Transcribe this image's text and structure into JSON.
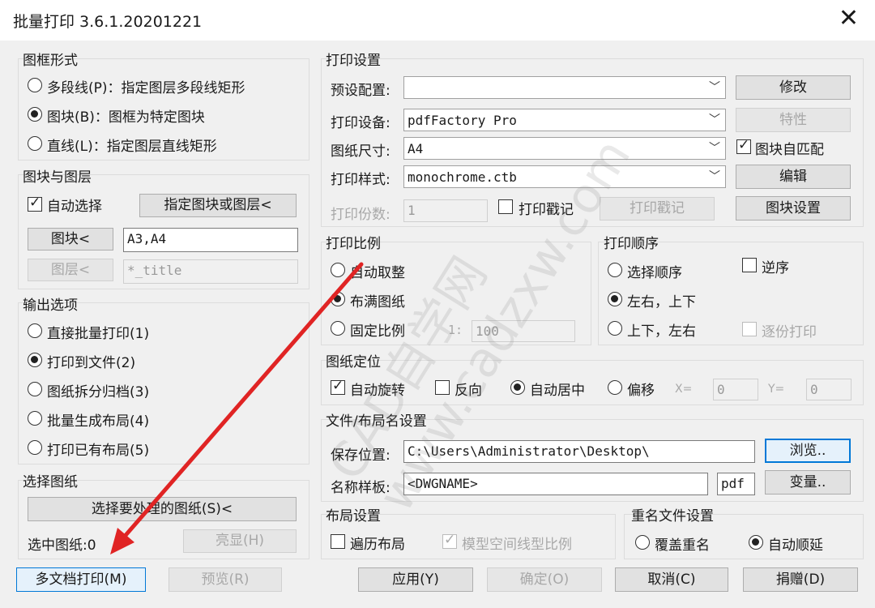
{
  "window": {
    "title": "批量打印 3.6.1.20201221",
    "close_icon": "close-icon"
  },
  "frame_style": {
    "label": "图框形式",
    "options": [
      {
        "text": "多段线(P)：指定图层多段线矩形",
        "selected": false
      },
      {
        "text": "图块(B)：图框为特定图块",
        "selected": true
      },
      {
        "text": "直线(L)：指定图层直线矩形",
        "selected": false
      }
    ]
  },
  "block_layer": {
    "label": "图块与图层",
    "auto_select": "自动选择",
    "specify_button": "指定图块或图层<",
    "block_button": "图块<",
    "block_value": "A3,A4",
    "layer_button": "图层<",
    "layer_value": "*_title"
  },
  "output": {
    "label": "输出选项",
    "options": [
      {
        "text": "直接批量打印(1)",
        "selected": false
      },
      {
        "text": "打印到文件(2)",
        "selected": true
      },
      {
        "text": "图纸拆分归档(3)",
        "selected": false
      },
      {
        "text": "批量生成布局(4)",
        "selected": false
      },
      {
        "text": "打印已有布局(5)",
        "selected": false
      }
    ]
  },
  "select_drawing": {
    "label": "选择图纸",
    "select_button": "选择要处理的图纸(S)<",
    "count_text": "选中图纸:0",
    "highlight_button": "亮显(H)"
  },
  "print_settings": {
    "label": "打印设置",
    "preset_label": "预设配置:",
    "preset_value": "",
    "modify_button": "修改",
    "device_label": "打印设备:",
    "device_value": "pdfFactory Pro",
    "props_button": "特性",
    "paper_label": "图纸尺寸:",
    "paper_value": "A4",
    "match_label": "图块自匹配",
    "style_label": "打印样式:",
    "style_value": "monochrome.ctb",
    "edit_button": "编辑",
    "copies_label": "打印份数:",
    "copies_value": "1",
    "stamp_label": "打印戳记",
    "stamp_button": "打印戳记",
    "block_settings_button": "图块设置"
  },
  "scale": {
    "label": "打印比例",
    "options": [
      {
        "text": "自动取整",
        "selected": false
      },
      {
        "text": "布满图纸",
        "selected": true
      },
      {
        "text": "固定比例",
        "selected": false
      }
    ],
    "ratio_prefix": "1:",
    "ratio_value": "100"
  },
  "order": {
    "label": "打印顺序",
    "options": [
      {
        "text": "选择顺序",
        "selected": false
      },
      {
        "text": "左右，上下",
        "selected": true
      },
      {
        "text": "上下，左右",
        "selected": false
      }
    ],
    "reverse_label": "逆序",
    "collate_label": "逐份打印"
  },
  "position": {
    "label": "图纸定位",
    "auto_rotate": "自动旋转",
    "reverse": "反向",
    "auto_center": "自动居中",
    "offset": "偏移",
    "x_label": "X=",
    "x_value": "0",
    "y_label": "Y=",
    "y_value": "0"
  },
  "file_name": {
    "label": "文件/布局名设置",
    "save_label": "保存位置:",
    "save_value": "C:\\Users\\Administrator\\Desktop\\",
    "browse_button": "浏览..",
    "name_label": "名称样板:",
    "name_value": "<DWGNAME>",
    "ext_value": "pdf",
    "vars_button": "变量.."
  },
  "layout": {
    "label": "布局设置",
    "traverse_label": "遍历布局",
    "model_linetype_label": "模型空间线型比例"
  },
  "rename": {
    "label": "重名文件设置",
    "overwrite_label": "覆盖重名",
    "auto_label": "自动顺延"
  },
  "bottom": {
    "multi_print": "多文档打印(M)",
    "preview": "预览(R)",
    "apply": "应用(Y)",
    "ok": "确定(O)",
    "cancel": "取消(C)",
    "donate": "捐赠(D)"
  },
  "watermark": {
    "text": "CAD自学网 www.cadzxw.com"
  },
  "colors": {
    "arrow": "#e02424",
    "accent": "#0078d7"
  }
}
